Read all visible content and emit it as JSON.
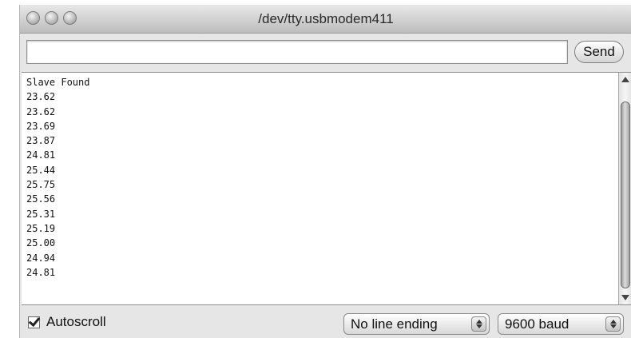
{
  "window": {
    "title": "/dev/tty.usbmodem411"
  },
  "send_bar": {
    "input_value": "",
    "send_label": "Send"
  },
  "output": {
    "lines": [
      "Slave Found",
      "23.62",
      "23.62",
      "23.69",
      "23.87",
      "24.81",
      "25.44",
      "25.75",
      "25.56",
      "25.31",
      "25.19",
      "25.00",
      "24.94",
      "24.81"
    ]
  },
  "footer": {
    "autoscroll_label": "Autoscroll",
    "autoscroll_checked": true,
    "line_ending_selected": "No line ending",
    "baud_selected": "9600 baud"
  },
  "icons": {
    "window_controls": [
      "close-button-icon",
      "minimize-button-icon",
      "zoom-button-icon"
    ],
    "scroll_up": "scroll-up-arrow-icon",
    "scroll_down": "scroll-down-arrow-icon",
    "select_arrows": "up-down-arrows-icon",
    "checkbox": "check-icon"
  }
}
